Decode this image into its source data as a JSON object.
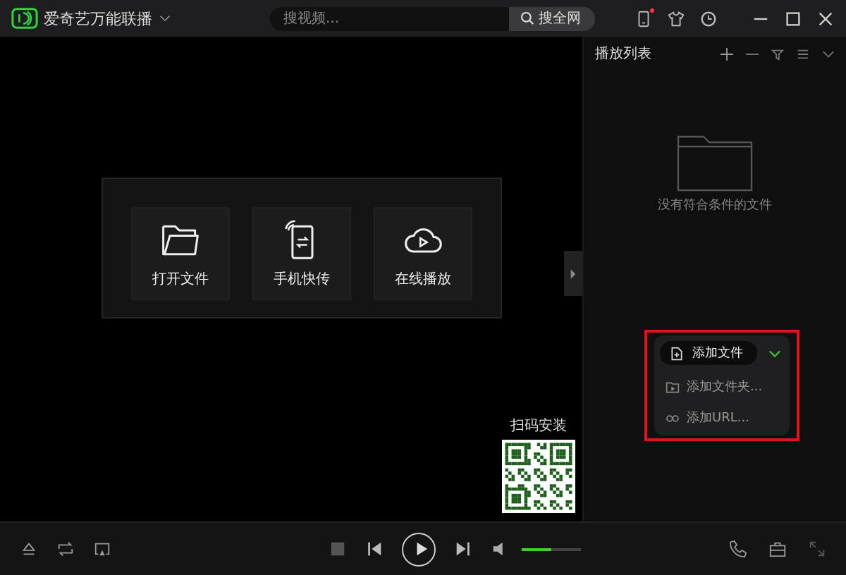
{
  "app": {
    "title": "爱奇艺万能联播",
    "search": {
      "placeholder": "搜视频...",
      "button": "搜全网"
    },
    "notification_dot": true
  },
  "quick_actions": [
    {
      "label": "打开文件",
      "kind": "folder"
    },
    {
      "label": "手机快传",
      "kind": "phone"
    },
    {
      "label": "在线播放",
      "kind": "cloud"
    }
  ],
  "qr": {
    "label": "扫码安装"
  },
  "playlist": {
    "title": "播放列表",
    "empty_text": "没有符合条件的文件",
    "add_menu": {
      "primary": "添加文件",
      "items": [
        {
          "label": "添加文件夹...",
          "kind": "folder"
        },
        {
          "label": "添加URL...",
          "kind": "link"
        }
      ]
    }
  },
  "player": {
    "volume": {
      "level": 0.5
    }
  }
}
